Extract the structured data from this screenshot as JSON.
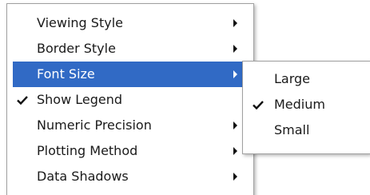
{
  "main_menu": {
    "items": [
      {
        "label": "Viewing Style",
        "has_submenu": true,
        "checked": false
      },
      {
        "label": "Border Style",
        "has_submenu": true,
        "checked": false
      },
      {
        "label": "Font Size",
        "has_submenu": true,
        "checked": false,
        "highlighted": true
      },
      {
        "label": "Show Legend",
        "has_submenu": false,
        "checked": true
      },
      {
        "label": "Numeric Precision",
        "has_submenu": true,
        "checked": false
      },
      {
        "label": "Plotting Method",
        "has_submenu": true,
        "checked": false
      },
      {
        "label": "Data Shadows",
        "has_submenu": true,
        "checked": false
      }
    ]
  },
  "font_size_submenu": {
    "items": [
      {
        "label": "Large",
        "checked": false
      },
      {
        "label": "Medium",
        "checked": true
      },
      {
        "label": "Small",
        "checked": false
      }
    ]
  },
  "colors": {
    "highlight": "#316ac5",
    "highlight_text": "#ffffff",
    "text": "#1a1a1a"
  }
}
